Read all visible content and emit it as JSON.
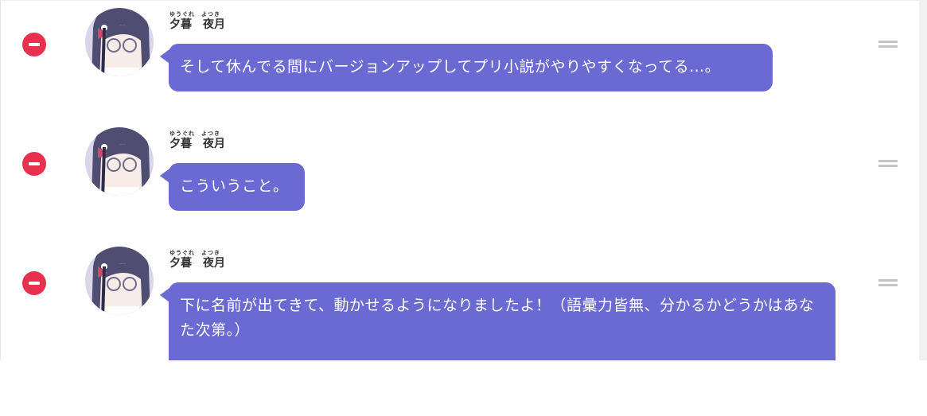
{
  "messages": [
    {
      "speaker_ruby": "ゆうぐれ　よつき",
      "speaker_name": "夕暮　夜月",
      "text": "そして休んでる間にバージョンアップしてプリ小説がやりやすくなってる…。"
    },
    {
      "speaker_ruby": "ゆうぐれ　よつき",
      "speaker_name": "夕暮　夜月",
      "text": "こういうこと。"
    },
    {
      "speaker_ruby": "ゆうぐれ　よつき",
      "speaker_name": "夕暮　夜月",
      "text": "下に名前が出てきて、動かせるようになりましたよ！（語彙力皆無、分かるかどうかはあなた次第。）"
    }
  ],
  "icons": {
    "remove": "minus-circle-icon",
    "drag": "drag-handle-icon",
    "avatar": "character-avatar"
  },
  "colors": {
    "bubble": "#6a6ad2",
    "remove": "#e8304f",
    "handle": "#c4c4c4"
  }
}
